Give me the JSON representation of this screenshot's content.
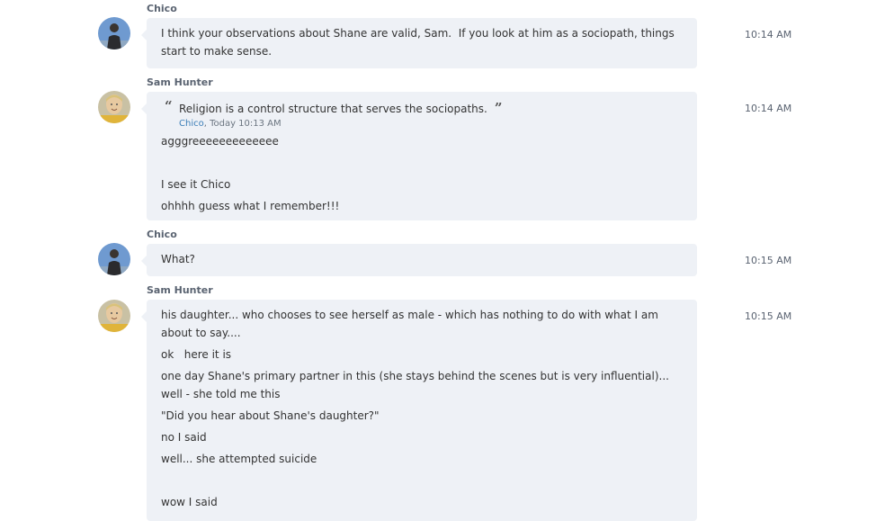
{
  "messages": [
    {
      "sender": "Chico",
      "time": "10:14 AM",
      "lines": [
        "I think your observations about Shane are valid, Sam.  If you look at him as a sociopath, things",
        "start to make sense."
      ]
    },
    {
      "sender": "Sam Hunter",
      "time": "10:14 AM",
      "quote": {
        "text": "Religion is a control structure that serves the sociopaths.",
        "author": "Chico",
        "meta": ", Today 10:13 AM"
      },
      "lines": [
        "agggreeeeeeeeeeeee",
        "",
        "I see it Chico",
        "ohhhh guess what I remember!!!"
      ]
    },
    {
      "sender": "Chico",
      "time": "10:15 AM",
      "lines": [
        "What?"
      ]
    },
    {
      "sender": "Sam Hunter",
      "time": "10:15 AM",
      "lines": [
        "his daughter... who chooses to see herself as male - which has nothing to do with what I am",
        "about to say....",
        "ok   here it is",
        "one day Shane's primary partner in this (she stays behind the scenes but is very influential)...",
        "well - she told me this",
        "\"Did you hear about Shane's daughter?\"",
        "no I said",
        "well... she attempted suicide",
        "",
        "wow I said"
      ]
    }
  ],
  "colors": {
    "bubble": "#eef1f6",
    "sender": "#5a6371",
    "quote_author": "#3d7fb8"
  }
}
